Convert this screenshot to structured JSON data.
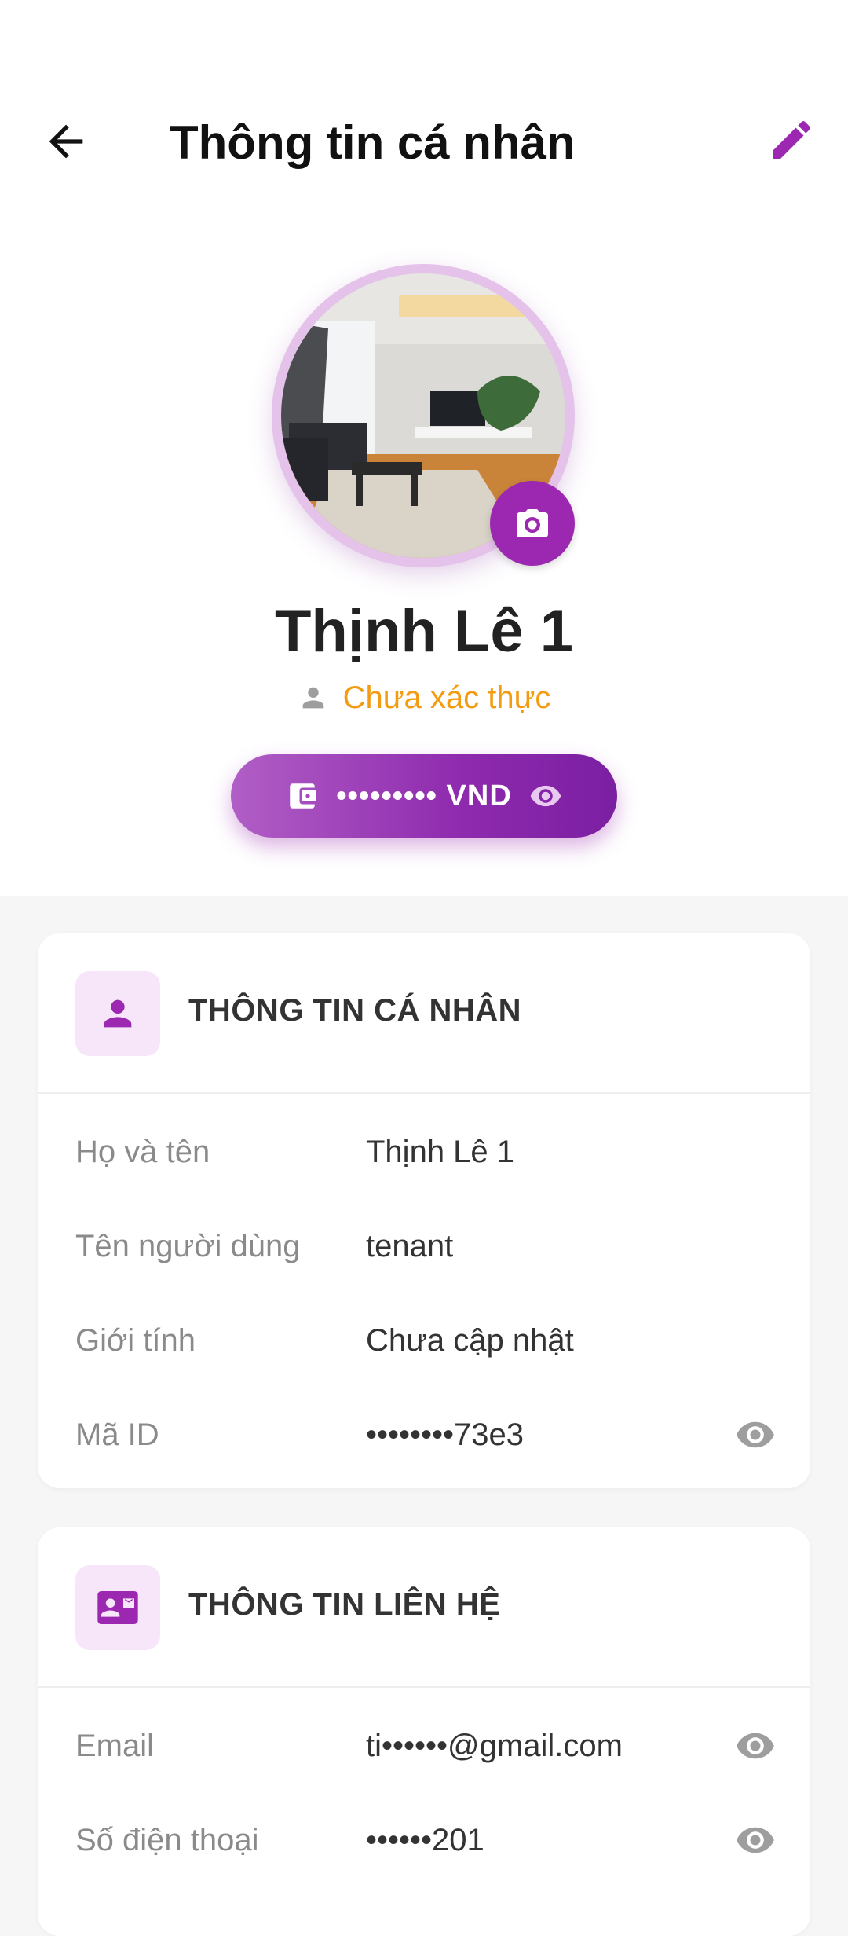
{
  "header": {
    "title": "Thông tin cá nhân"
  },
  "profile": {
    "name": "Thịnh Lê 1",
    "verification_status": "Chưa xác thực",
    "balance_masked": "••••••••• VND"
  },
  "personal_info": {
    "title": "THÔNG TIN CÁ NHÂN",
    "rows": [
      {
        "label": "Họ và tên",
        "value": "Thịnh Lê 1"
      },
      {
        "label": "Tên người dùng",
        "value": "tenant"
      },
      {
        "label": "Giới tính",
        "value": "Chưa cập nhật"
      },
      {
        "label": "Mã ID",
        "value": "••••••••73e3"
      }
    ]
  },
  "contact_info": {
    "title": "THÔNG TIN LIÊN HỆ",
    "rows": [
      {
        "label": "Email",
        "value": "ti••••••@gmail.com"
      },
      {
        "label": "Số điện thoại",
        "value": "••••••201"
      }
    ]
  },
  "colors": {
    "accent": "#9c27b0",
    "warning": "#f39c12",
    "background": "#f6f6f6"
  },
  "icons": [
    "back-arrow-icon",
    "edit-pencil-icon",
    "camera-icon",
    "person-icon",
    "wallet-icon",
    "eye-icon",
    "contact-card-icon"
  ]
}
